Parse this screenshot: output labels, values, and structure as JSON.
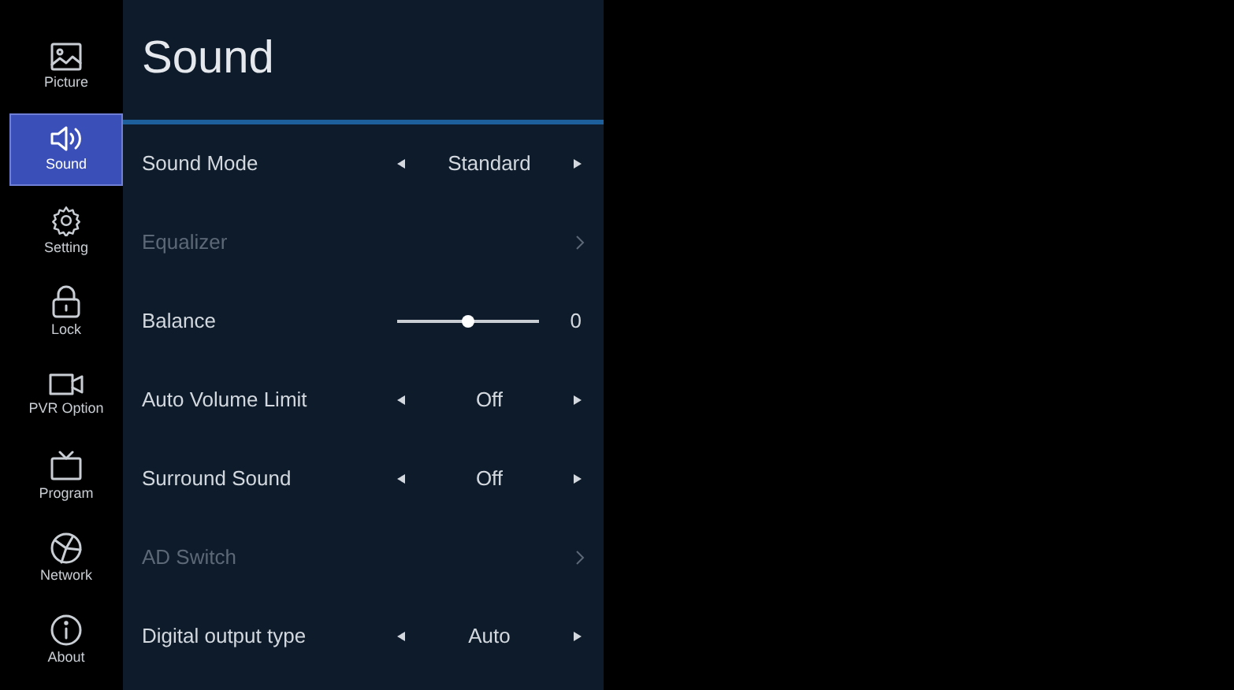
{
  "sidebar": {
    "items": [
      {
        "label": "Picture",
        "selected": false
      },
      {
        "label": "Sound",
        "selected": true
      },
      {
        "label": "Setting",
        "selected": false
      },
      {
        "label": "Lock",
        "selected": false
      },
      {
        "label": "PVR Option",
        "selected": false
      },
      {
        "label": "Program",
        "selected": false
      },
      {
        "label": "Network",
        "selected": false
      },
      {
        "label": "About",
        "selected": false
      }
    ]
  },
  "panel": {
    "title": "Sound",
    "rows": [
      {
        "kind": "select",
        "label": "Sound Mode",
        "value": "Standard",
        "disabled": false
      },
      {
        "kind": "submenu",
        "label": "Equalizer",
        "disabled": true
      },
      {
        "kind": "slider",
        "label": "Balance",
        "level": 0.5,
        "reading": "0",
        "disabled": false
      },
      {
        "kind": "select",
        "label": "Auto Volume Limit",
        "value": "Off",
        "disabled": false
      },
      {
        "kind": "select",
        "label": "Surround Sound",
        "value": "Off",
        "disabled": false
      },
      {
        "kind": "submenu",
        "label": "AD Switch",
        "disabled": true
      },
      {
        "kind": "select",
        "label": "Digital output type",
        "value": "Auto",
        "disabled": false
      }
    ]
  }
}
